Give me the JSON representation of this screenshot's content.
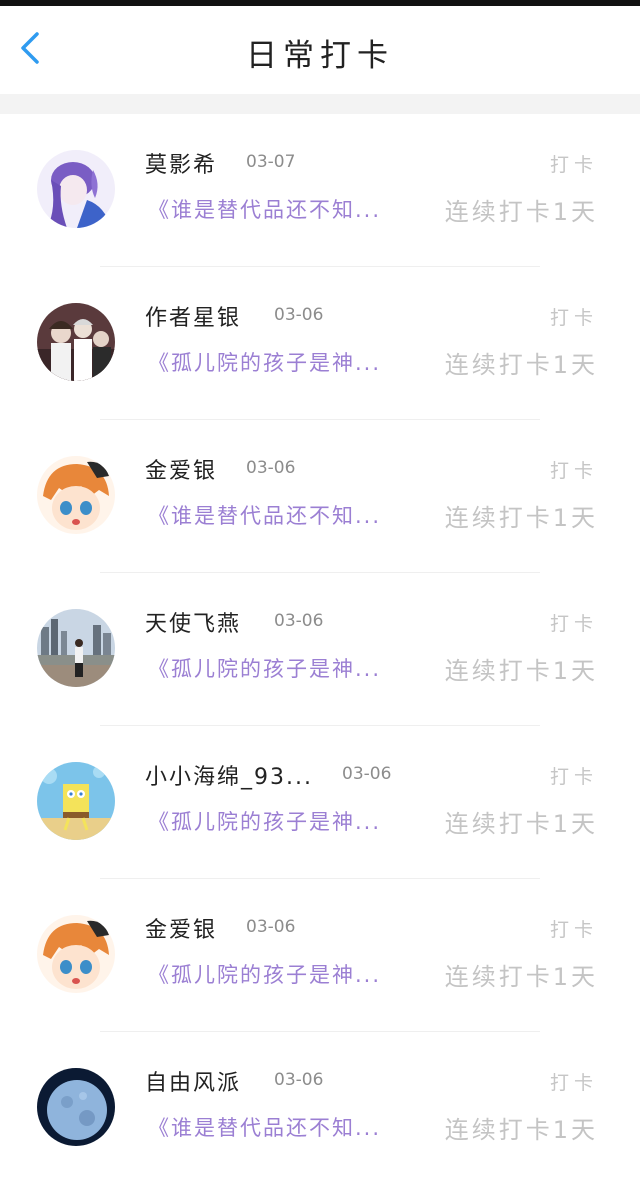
{
  "header": {
    "title": "日常打卡",
    "back_icon": "chevron-left-icon",
    "accent_color": "#2f9bf0"
  },
  "colors": {
    "quote": "#9b7fd3",
    "muted": "#c4c4c4",
    "date": "#8c8c8c"
  },
  "checkins": [
    {
      "name": "莫影希",
      "date": "03-07",
      "action_label": "打卡",
      "quote": "《谁是替代品还不知...",
      "streak": "连续打卡1天",
      "avatar": "anime-purple-hair-avatar"
    },
    {
      "name": "作者星银",
      "date": "03-06",
      "action_label": "打卡",
      "quote": "《孤儿院的孩子是神...",
      "streak": "连续打卡1天",
      "avatar": "group-anime-avatar"
    },
    {
      "name": "金爱银",
      "date": "03-06",
      "action_label": "打卡",
      "quote": "《谁是替代品还不知...",
      "streak": "连续打卡1天",
      "avatar": "orange-hair-anime-avatar"
    },
    {
      "name": "天使飞燕",
      "date": "03-06",
      "action_label": "打卡",
      "quote": "《孤儿院的孩子是神...",
      "streak": "连续打卡1天",
      "avatar": "city-photo-avatar"
    },
    {
      "name": "小小海绵_93...",
      "date": "03-06",
      "action_label": "打卡",
      "quote": "《孤儿院的孩子是神...",
      "streak": "连续打卡1天",
      "avatar": "spongebob-avatar"
    },
    {
      "name": "金爱银",
      "date": "03-06",
      "action_label": "打卡",
      "quote": "《孤儿院的孩子是神...",
      "streak": "连续打卡1天",
      "avatar": "orange-hair-anime-avatar"
    },
    {
      "name": "自由风派",
      "date": "03-06",
      "action_label": "打卡",
      "quote": "《谁是替代品还不知...",
      "streak": "连续打卡1天",
      "avatar": "moon-avatar"
    }
  ]
}
